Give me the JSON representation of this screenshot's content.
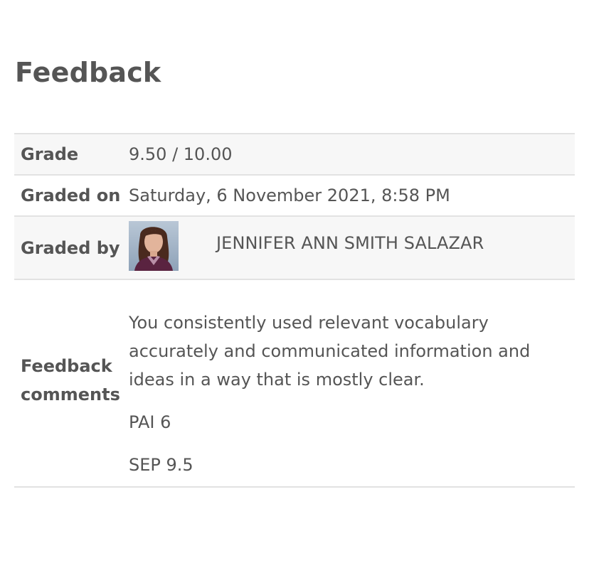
{
  "heading": "Feedback",
  "rows": {
    "grade": {
      "label": "Grade",
      "value": "9.50 / 10.00"
    },
    "graded_on": {
      "label": "Graded on",
      "value": "Saturday, 6 November 2021, 8:58 PM"
    },
    "graded_by": {
      "label": "Graded by",
      "name": "JENNIFER ANN SMITH SALAZAR",
      "avatar_icon": "user-avatar-photo"
    },
    "comments": {
      "label_line1": "Feedback",
      "label_line2": "comments",
      "paragraphs": [
        "You consistently used relevant vocabulary accurately and communicated information and ideas in a way that is mostly clear.",
        "PAI 6",
        "SEP 9.5"
      ]
    }
  },
  "colors": {
    "text": "#555555",
    "border": "#e2e2e2",
    "row_shade": "#f7f7f7"
  }
}
